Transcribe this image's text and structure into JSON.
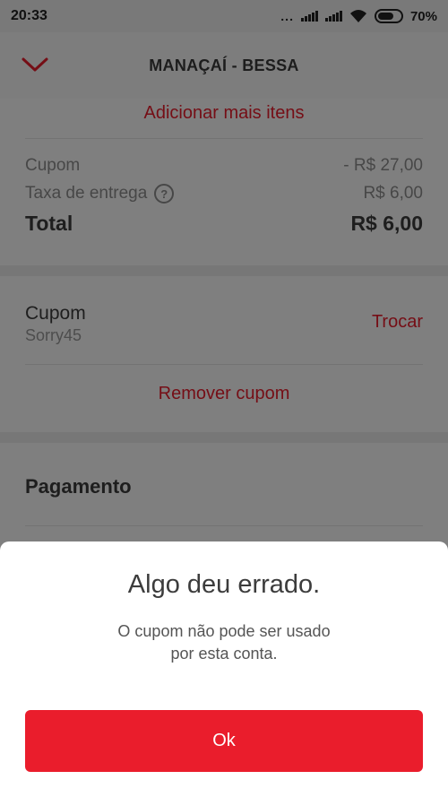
{
  "status_bar": {
    "time": "20:33",
    "dots": "...",
    "battery_percent": "70%",
    "battery_level": 0.7,
    "icons": [
      "signal-icon",
      "signal-icon",
      "wifi-icon",
      "battery-icon"
    ]
  },
  "header": {
    "title": "MANAÇAÍ - BESSA",
    "back_icon": "chevron-down-icon"
  },
  "order": {
    "add_items_label": "Adicionar mais itens",
    "summary": [
      {
        "label": "Cupom",
        "value": "- R$ 27,00"
      },
      {
        "label": "Taxa de entrega",
        "value": "R$ 6,00",
        "help_icon": "?"
      }
    ],
    "total": {
      "label": "Total",
      "value": "R$ 6,00"
    }
  },
  "coupon": {
    "title": "Cupom",
    "code": "Sorry45",
    "change_label": "Trocar",
    "remove_label": "Remover cupom"
  },
  "payment": {
    "title": "Pagamento"
  },
  "dialog": {
    "title": "Algo deu errado.",
    "message_line1": "O cupom não pode ser usado",
    "message_line2": "por esta conta.",
    "ok_label": "Ok"
  },
  "colors": {
    "accent": "#ea1d2c",
    "overlay": "rgba(0,0,0,0.5)"
  }
}
